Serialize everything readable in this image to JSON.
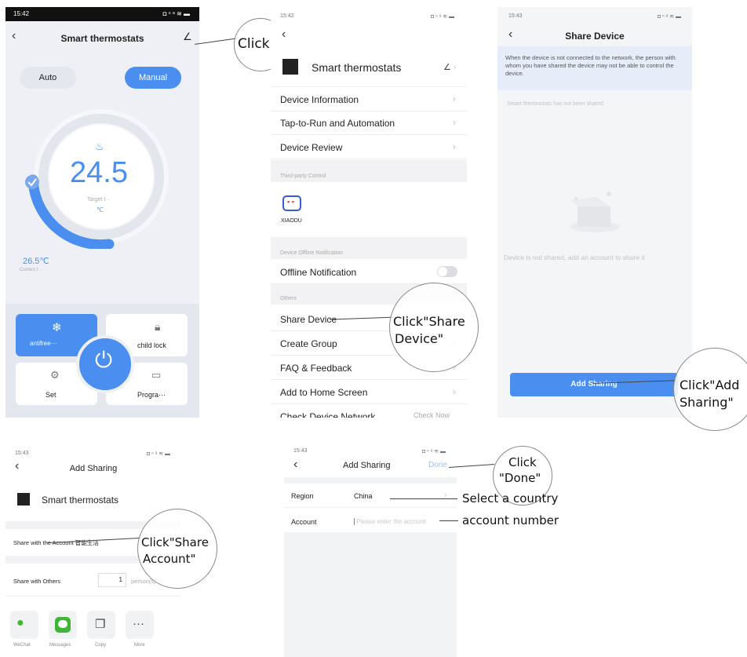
{
  "s1": {
    "time": "15:42",
    "status_icons": "◘ ⁿ ᵃ ≋ ▬",
    "title": "Smart thermostats",
    "mode_auto": "Auto",
    "mode_manual": "Manual",
    "target_temp": "24.5",
    "target_label": "Target t···",
    "unit": "℃",
    "current_temp": "26.5℃",
    "current_label": "Current t···",
    "tile_antifreeze": "antifree···",
    "tile_childlock": "child lock",
    "tile_set": "Set",
    "tile_program": "Progra···"
  },
  "s2": {
    "time": "15:42",
    "status_icons": "◘ ⁿ ᵃ ≋ ▬",
    "device_name": "Smart thermostats",
    "items": [
      "Device Information",
      "Tap-to-Run and Automation",
      "Device Review"
    ],
    "section_third_party": "Third-party Control",
    "xiaodu_label": "XIAODU",
    "section_offline": "Device Offline Notification",
    "offline_item": "Offline Notification",
    "section_others": "Others",
    "others_items": [
      "Share Device",
      "Create Group",
      "FAQ & Feedback",
      "Add to Home Screen"
    ],
    "check_network": "Check Device Network",
    "check_now": "Check Now"
  },
  "s3": {
    "time": "15:43",
    "status_icons": "◘ ⁿ ᵃ ≋ ▬",
    "title": "Share Device",
    "notice": "When the device is not connected to the network, the person with whom you have shared the device may not be able to control the device.",
    "not_shared": "Smart thermostats   has not been shared",
    "empty_text": "Device is not shared, add an account to share it",
    "add_button": "Add Sharing"
  },
  "s4": {
    "time": "15:43",
    "status_icons": "◘ ⁿ ᵃ ≋ ▬",
    "title": "Add Sharing",
    "device_name": "Smart thermostats",
    "share_account": "Share with the Account 智能生活",
    "share_others": "Share with Others",
    "persons_value": "1",
    "persons_unit": "person(s)",
    "apps": [
      "WeChat",
      "Messages",
      "Copy",
      "More"
    ]
  },
  "s5": {
    "time": "15:43",
    "status_icons": "◘ ⁿ ᵃ ≋ ▬",
    "title": "Add Sharing",
    "done": "Done",
    "region_label": "Region",
    "region_value": "China",
    "account_label": "Account",
    "account_placeholder": "Please enter the account"
  },
  "annotations": {
    "click": "Click",
    "click_share_device_1": "Click\"Share",
    "click_share_device_2": "Device\"",
    "click_add_sharing_1": "Click\"Add",
    "click_add_sharing_2": "Sharing\"",
    "click_share_account_1": "Click\"Share",
    "click_share_account_2": "Account\"",
    "click_done_1": "Click",
    "click_done_2": "\"Done\"",
    "select_country": "Select a country",
    "account_number": "account number"
  },
  "colors": {
    "accent": "#4a8ef0",
    "panel": "#eef0f5"
  }
}
